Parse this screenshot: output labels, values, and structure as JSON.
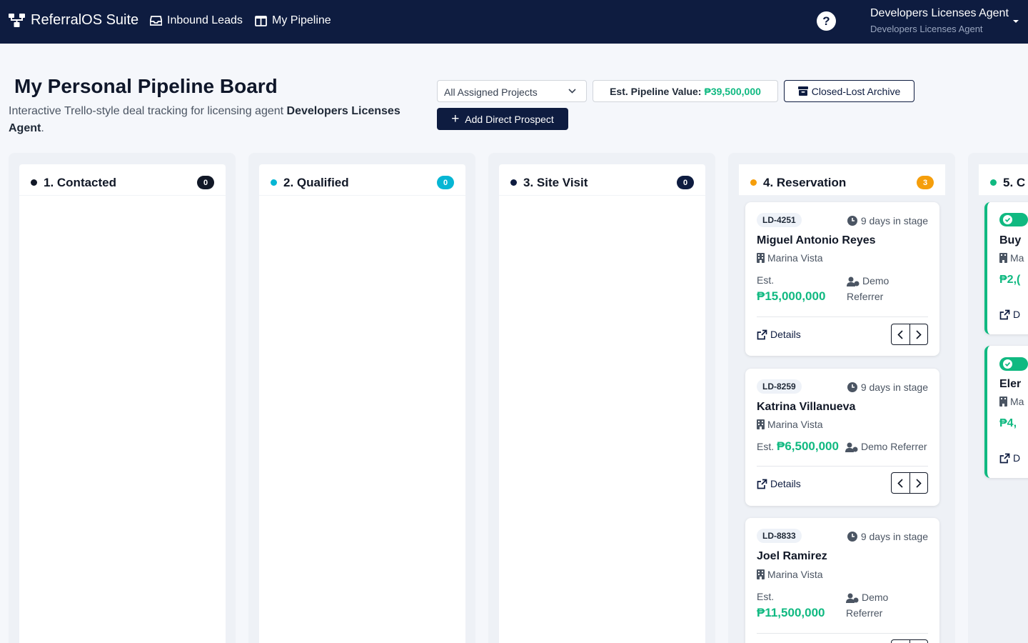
{
  "navbar": {
    "brand": "ReferralOS Suite",
    "links": [
      {
        "label": "Inbound Leads",
        "icon": "inbox-icon"
      },
      {
        "label": "My Pipeline",
        "icon": "columns-icon"
      }
    ],
    "help": "?",
    "user_name": "Developers Licenses Agent",
    "user_role": "Developers Licenses Agent"
  },
  "header": {
    "title": "My Personal Pipeline Board",
    "subtitle_prefix": "Interactive Trello-style deal tracking for licensing agent ",
    "subtitle_agent": "Developers Licenses Agent",
    "subtitle_suffix": ".",
    "project_select": "All Assigned Projects",
    "pipeline_label": "Est. Pipeline Value:",
    "pipeline_value": "₱39,500,000",
    "archive_label": "Closed-Lost Archive",
    "add_label": "Add Direct Prospect"
  },
  "colors": {
    "navy": "#0e1c40",
    "green": "#10b981",
    "cyan": "#06b6d4",
    "orange": "#f59e0b"
  },
  "columns": [
    {
      "title": "1. Contacted",
      "count": "0"
    },
    {
      "title": "2. Qualified",
      "count": "0"
    },
    {
      "title": "3. Site Visit",
      "count": "0"
    },
    {
      "title": "4. Reservation",
      "count": "3"
    },
    {
      "title": "5. C"
    }
  ],
  "cards": [
    {
      "id": "LD-4251",
      "days": "9 days in stage",
      "name": "Miguel Antonio Reyes",
      "project": "Marina Vista",
      "est_label": "Est.",
      "value": "₱15,000,000",
      "referrer_a": "Demo",
      "referrer_b": "Referrer",
      "details": "Details"
    },
    {
      "id": "LD-8259",
      "days": "9 days in stage",
      "name": "Katrina Villanueva",
      "project": "Marina Vista",
      "est_label": "Est.",
      "value": "₱6,500,000",
      "referrer": "Demo Referrer",
      "details": "Details"
    },
    {
      "id": "LD-8833",
      "days": "9 days in stage",
      "name": "Joel Ramirez",
      "project": "Marina Vista",
      "est_label": "Est.",
      "value": "₱11,500,000",
      "referrer_a": "Demo",
      "referrer_b": "Referrer",
      "details": "Details"
    }
  ],
  "partial_cards": [
    {
      "name": "Buy",
      "project": "Ma",
      "value": "₱2,(",
      "details": "D"
    },
    {
      "name": "Eler",
      "project": "Ma",
      "value": "₱4,",
      "details": "D"
    }
  ]
}
